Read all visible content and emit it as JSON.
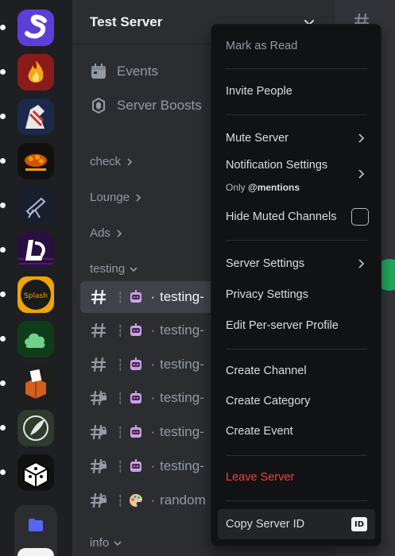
{
  "server": {
    "name": "Test Server"
  },
  "sidebar": {
    "links": [
      {
        "label": "Events",
        "icon": "calendar-icon"
      },
      {
        "label": "Server Boosts",
        "icon": "boost-icon"
      }
    ],
    "categories": [
      "check",
      "Lounge",
      "Ads",
      "testing",
      "info"
    ],
    "channels": [
      {
        "name": "testing-",
        "emoji": "robot-emoji",
        "locked": false,
        "active": true
      },
      {
        "name": "testing-",
        "emoji": "robot-emoji",
        "locked": false,
        "active": false
      },
      {
        "name": "testing-",
        "emoji": "robot-emoji",
        "locked": false,
        "active": false
      },
      {
        "name": "testing-",
        "emoji": "robot-emoji",
        "locked": true,
        "active": false
      },
      {
        "name": "testing-",
        "emoji": "robot-emoji",
        "locked": true,
        "active": false
      },
      {
        "name": "testing-",
        "emoji": "robot-emoji",
        "locked": true,
        "active": false
      },
      {
        "name": "random",
        "emoji": "palette-emoji",
        "locked": true,
        "active": false
      }
    ],
    "separator": "┆",
    "bullet": "·"
  },
  "menu": {
    "items": {
      "mark_as_read": "Mark as Read",
      "invite_people": "Invite People",
      "mute_server": "Mute Server",
      "notification_settings": "Notification Settings",
      "notification_sub_prefix": "Only ",
      "notification_sub_value": "@mentions",
      "hide_muted_channels": "Hide Muted Channels",
      "server_settings": "Server Settings",
      "privacy_settings": "Privacy Settings",
      "edit_profile": "Edit Per-server Profile",
      "create_channel": "Create Channel",
      "create_category": "Create Category",
      "create_event": "Create Event",
      "leave_server": "Leave Server",
      "copy_server_id": "Copy Server ID",
      "id_badge": "ID"
    }
  },
  "colors": {
    "danger": "#f23f43",
    "active_bg": "#404249",
    "menu_bg": "#111214",
    "sidebar_bg": "#2b2d31"
  }
}
